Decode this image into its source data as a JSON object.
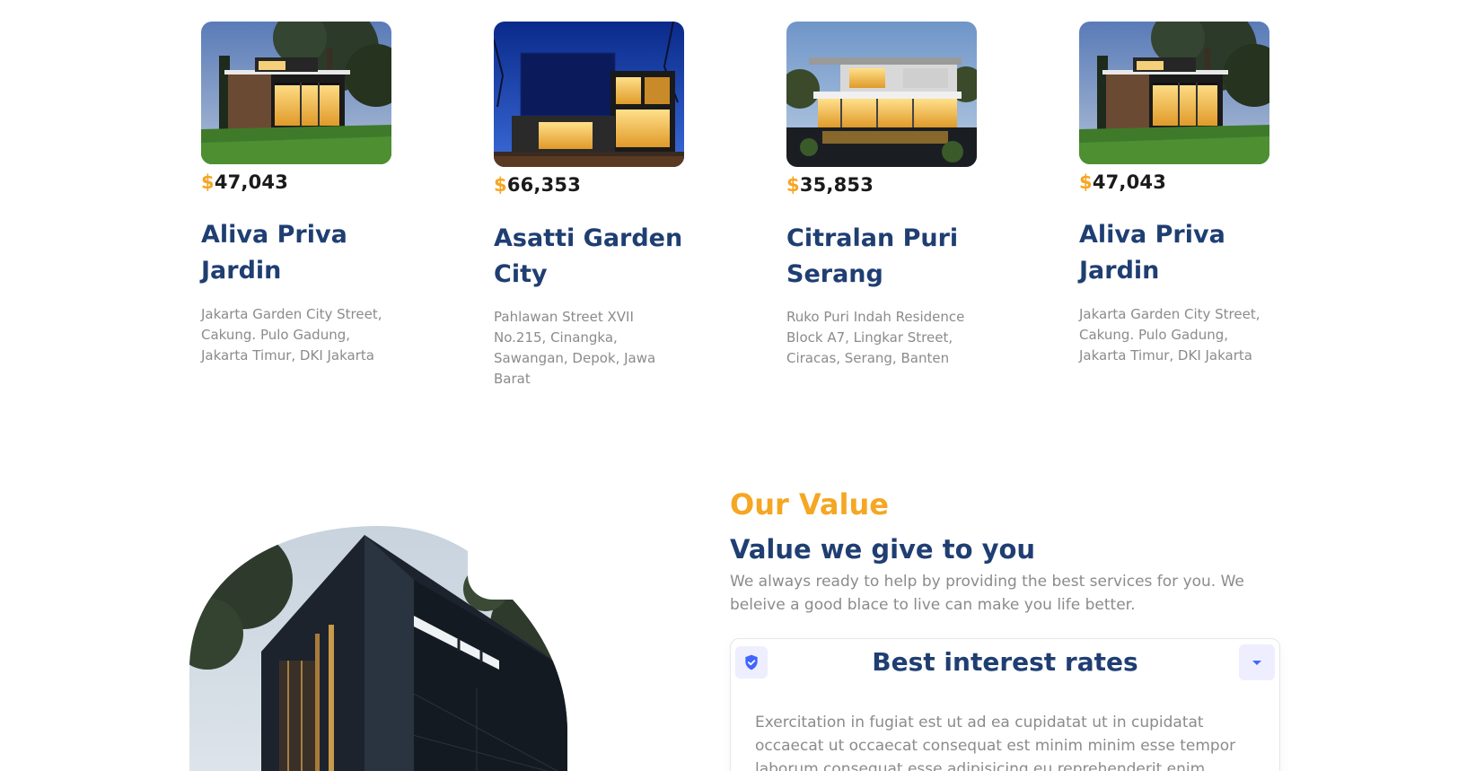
{
  "residencies": [
    {
      "image": "modern-house-with-tree-photo",
      "currency": "$",
      "price": "47,043",
      "name": "Aliva Priva Jardin",
      "address": "Jakarta Garden City Street, Cakung. Pulo Gadung, Jakarta Timur, DKI Jakarta"
    },
    {
      "image": "dark-cube-house-night-photo",
      "currency": "$",
      "price": "66,353",
      "name": "Asatti Garden City",
      "address": "Pahlawan Street XVII No.215, Cinangka, Sawangan, Depok, Jawa Barat"
    },
    {
      "image": "white-villa-with-pond-photo",
      "currency": "$",
      "price": "35,853",
      "name": "Citralan Puri Serang",
      "address": "Ruko Puri Indah Residence Block A7, Lingkar Street, Ciracas, Serang, Banten"
    },
    {
      "image": "modern-house-with-tree-photo",
      "currency": "$",
      "price": "47,043",
      "name": "Aliva Priva Jardin",
      "address": "Jakarta Garden City Street, Cakung. Pulo Gadung, Jakarta Timur, DKI Jakarta"
    }
  ],
  "value": {
    "label": "Our Value",
    "title": "Value we give to you",
    "description": "We always ready to help by providing the best services for you. We beleive a good blace to live can make you life better.",
    "image": "dark-modern-building-photo",
    "accordion": [
      {
        "icon": "shield-check-icon",
        "title": "Best interest rates",
        "toggle_icon": "caret-down-icon",
        "body": "Exercitation in fugiat est ut ad ea cupidatat ut in cupidatat occaecat ut occaecat consequat est minim minim esse tempor laborum consequat esse adipisicing eu reprehenderit enim."
      }
    ]
  },
  "colors": {
    "accent": "#f5a623",
    "primary": "#1f3e72",
    "secondary_text": "#8c8b8b",
    "icon_bg": "#eeeeff",
    "icon": "#4066ff"
  }
}
